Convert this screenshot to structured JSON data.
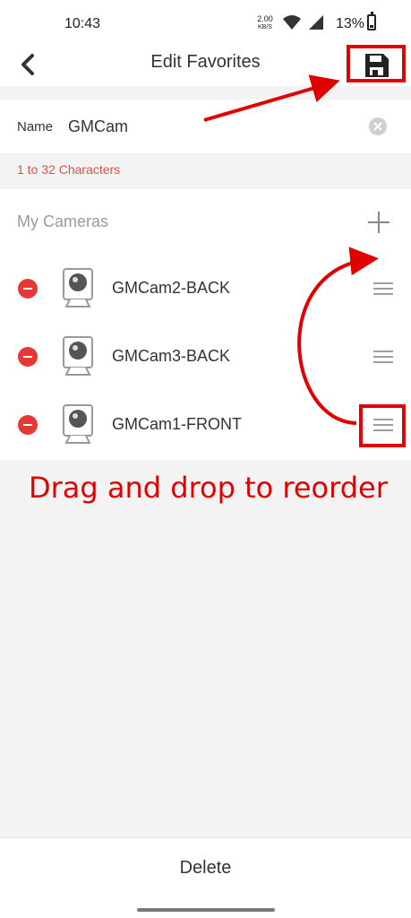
{
  "status_bar": {
    "time": "10:43",
    "speed_value": "2.00",
    "speed_unit": "KB/S",
    "battery": "13%"
  },
  "header": {
    "title": "Edit Favorites",
    "back_icon": "chevron-left-icon",
    "save_icon": "floppy-disk-icon"
  },
  "name_field": {
    "label": "Name",
    "value": "GMCam",
    "hint": "1 to 32 Characters",
    "clear_icon": "clear-icon"
  },
  "cameras": {
    "title": "My Cameras",
    "add_icon": "plus-icon",
    "items": [
      {
        "name": "GMCam2-BACK"
      },
      {
        "name": "GMCam3-BACK"
      },
      {
        "name": "GMCam1-FRONT"
      }
    ]
  },
  "annotation": {
    "text": "Drag and drop to reorder",
    "color": "#e00000"
  },
  "footer": {
    "delete_label": "Delete"
  },
  "colors": {
    "remove": "#e53935",
    "hint": "#e0504a"
  }
}
